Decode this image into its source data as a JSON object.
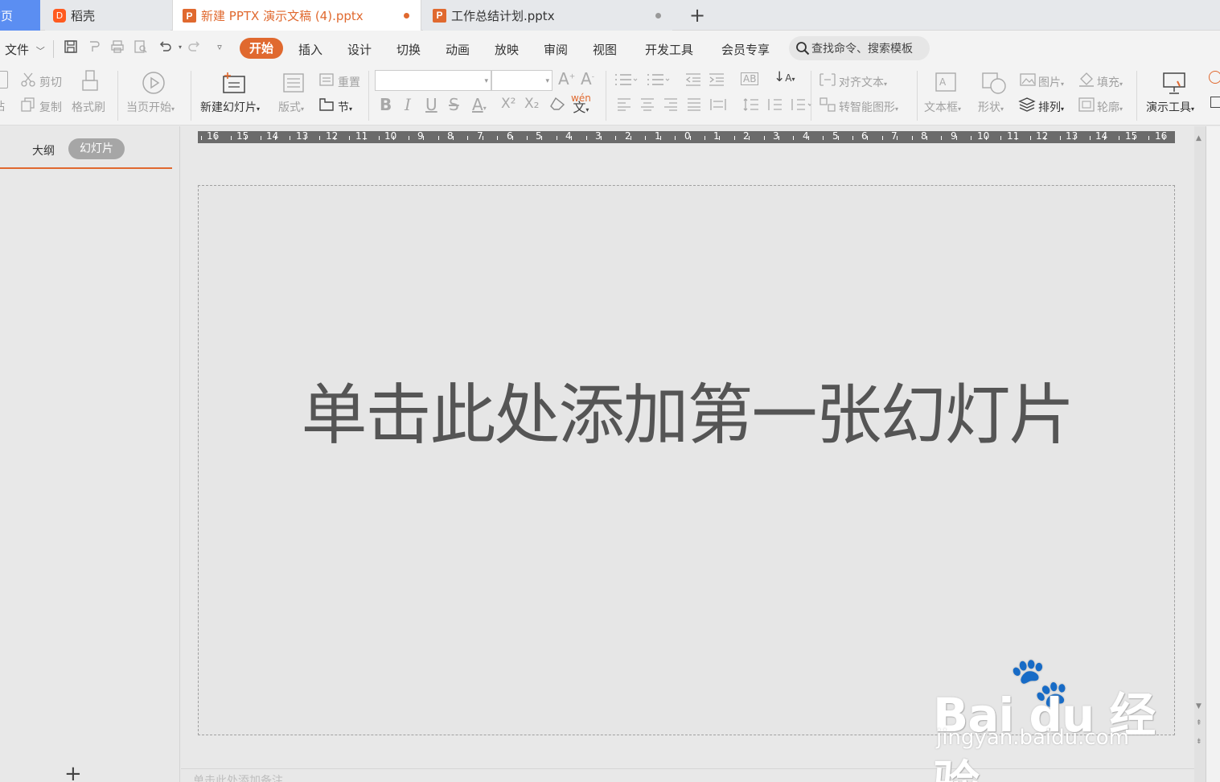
{
  "tabs": {
    "home": "首页",
    "daoke": "稻壳",
    "active_doc": "新建 PPTX 演示文稿 (4).pptx",
    "second_doc": "工作总结计划.pptx",
    "ppt_glyph": "P",
    "daoke_glyph": "D",
    "add": "+"
  },
  "menu": {
    "file": "文件",
    "file_arrow": "﹀",
    "items": [
      "开始",
      "插入",
      "设计",
      "切换",
      "动画",
      "放映",
      "审阅",
      "视图",
      "开发工具",
      "会员专享"
    ],
    "search_placeholder": "查找命令、搜索模板",
    "accent_color": "#e0692f"
  },
  "ribbon": {
    "cut": "剪切",
    "paste_partial": "粘",
    "copy": "复制",
    "format_painter": "格式刷",
    "play_from_current": "当页开始",
    "new_slide": "新建幻灯片",
    "layout": "版式",
    "reset": "重置",
    "section": "节",
    "bold": "B",
    "italic": "I",
    "underline": "U",
    "strikethrough": "S",
    "font_color": "A",
    "superscript": "X²",
    "subscript": "X₂",
    "phonetic": "wén",
    "align_text": "对齐文本",
    "smart_art": "转智能图形",
    "textbox": "文本框",
    "shape": "形状",
    "picture": "图片",
    "fill": "填充",
    "arrange": "排列",
    "outline": "轮廓",
    "presentation_tools": "演示工具"
  },
  "left_panel": {
    "outline_tab": "大纲",
    "slides_tab": "幻灯片",
    "add": "+"
  },
  "ruler": {
    "labels": [
      "16",
      "15",
      "14",
      "13",
      "12",
      "11",
      "10",
      "9",
      "8",
      "7",
      "6",
      "5",
      "4",
      "3",
      "2",
      "1",
      "0",
      "1",
      "2",
      "3",
      "4",
      "5",
      "6",
      "7",
      "8",
      "9",
      "10",
      "11",
      "12",
      "13",
      "14",
      "15",
      "16"
    ]
  },
  "slide": {
    "placeholder": "单击此处添加第一张幻灯片"
  },
  "notes": {
    "placeholder": "单击此处添加备注"
  },
  "watermark": {
    "logo": "Bai du 经验",
    "url": "jingyan.baidu.com"
  }
}
